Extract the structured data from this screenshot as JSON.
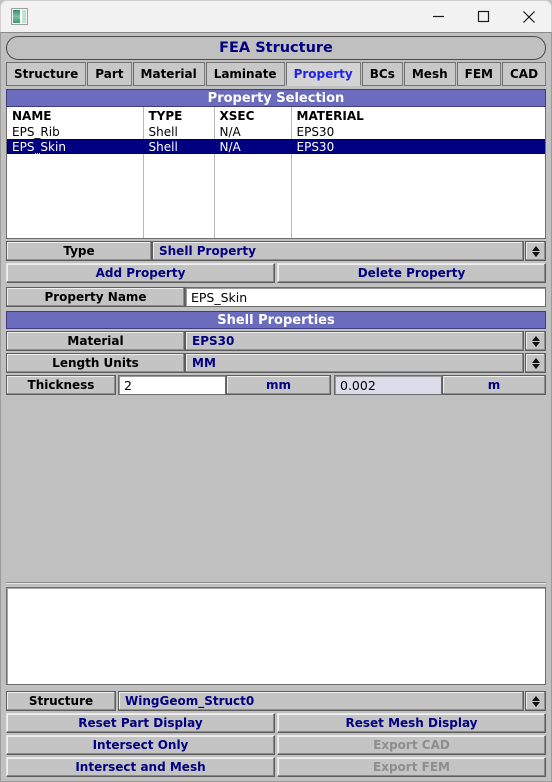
{
  "window": {
    "app_icon": "app-thumbnail-icon",
    "minimize_label": "minimize-icon",
    "maximize_label": "maximize-icon",
    "close_label": "close-icon"
  },
  "header": {
    "title": "FEA Structure"
  },
  "tabs": [
    {
      "label": "Structure",
      "active": false
    },
    {
      "label": "Part",
      "active": false
    },
    {
      "label": "Material",
      "active": false
    },
    {
      "label": "Laminate",
      "active": false
    },
    {
      "label": "Property",
      "active": true
    },
    {
      "label": "BCs",
      "active": false
    },
    {
      "label": "Mesh",
      "active": false
    },
    {
      "label": "FEM",
      "active": false
    },
    {
      "label": "CAD",
      "active": false
    }
  ],
  "property_selection": {
    "header": "Property Selection",
    "columns": [
      "NAME",
      "TYPE",
      "XSEC",
      "MATERIAL"
    ],
    "rows": [
      {
        "name": "EPS_Rib",
        "type": "Shell",
        "xsec": "N/A",
        "material": "EPS30",
        "selected": false
      },
      {
        "name": "EPS_Skin",
        "type": "Shell",
        "xsec": "N/A",
        "material": "EPS30",
        "selected": true
      }
    ]
  },
  "type_row": {
    "label": "Type",
    "value": "Shell Property"
  },
  "actions": {
    "add_property": "Add Property",
    "delete_property": "Delete Property"
  },
  "property_name": {
    "label": "Property Name",
    "value": "EPS_Skin"
  },
  "shell_properties": {
    "header": "Shell Properties",
    "material": {
      "label": "Material",
      "value": "EPS30"
    },
    "length_units": {
      "label": "Length Units",
      "value": "MM"
    },
    "thickness": {
      "label": "Thickness",
      "value": "2",
      "unit": "mm",
      "converted_value": "0.002",
      "converted_unit": "m"
    }
  },
  "console": {
    "text": ""
  },
  "footer": {
    "structure": {
      "label": "Structure",
      "value": "WingGeom_Struct0"
    },
    "buttons": [
      {
        "label": "Reset Part Display",
        "disabled": false
      },
      {
        "label": "Reset Mesh Display",
        "disabled": false
      },
      {
        "label": "Intersect Only",
        "disabled": false
      },
      {
        "label": "Export CAD",
        "disabled": true
      },
      {
        "label": "Intersect and Mesh",
        "disabled": false
      },
      {
        "label": "Export FEM",
        "disabled": true
      }
    ]
  },
  "colors": {
    "section_header_bg": "#6c6cbe",
    "selection_bg": "#000080",
    "accent_text": "#000080",
    "active_tab_text": "#2222ee",
    "face": "#c0c0c0"
  }
}
